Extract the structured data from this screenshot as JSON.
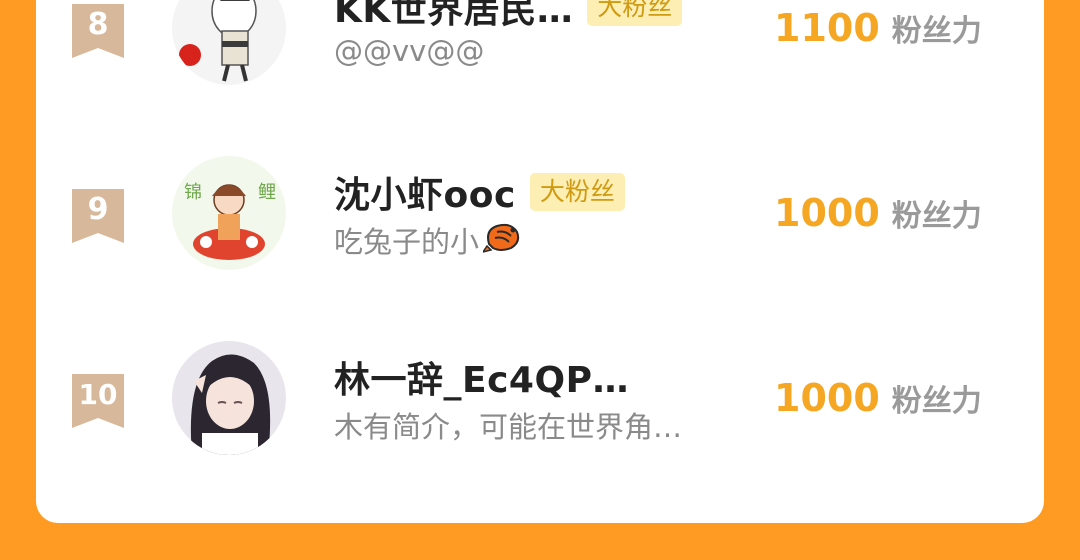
{
  "ranking": {
    "rows": [
      {
        "rank": "8",
        "name": "KK世界居民…",
        "badge": "大粉丝",
        "bio": "@@vv@@",
        "score": "1100",
        "score_unit": "粉丝力",
        "avatar_icon": "anime-character-avatar"
      },
      {
        "rank": "9",
        "name": "沈小虾ooc",
        "badge": "大粉丝",
        "bio": "吃兔子的小",
        "bio_icon": "shrimp-icon",
        "score": "1000",
        "score_unit": "粉丝力",
        "avatar_icon": "koi-girl-avatar"
      },
      {
        "rank": "10",
        "name": "林一辞_Ec4QP…",
        "badge": "",
        "bio": "木有简介，可能在世界角…",
        "score": "1000",
        "score_unit": "粉丝力",
        "avatar_icon": "anime-girl-avatar"
      }
    ]
  },
  "colors": {
    "background": "#ff9a22",
    "card": "#ffffff",
    "score": "#f5a623",
    "badge_bg": "#fdefb4",
    "badge_text": "#d09a12",
    "rank_ribbon": "#d8b89a"
  }
}
